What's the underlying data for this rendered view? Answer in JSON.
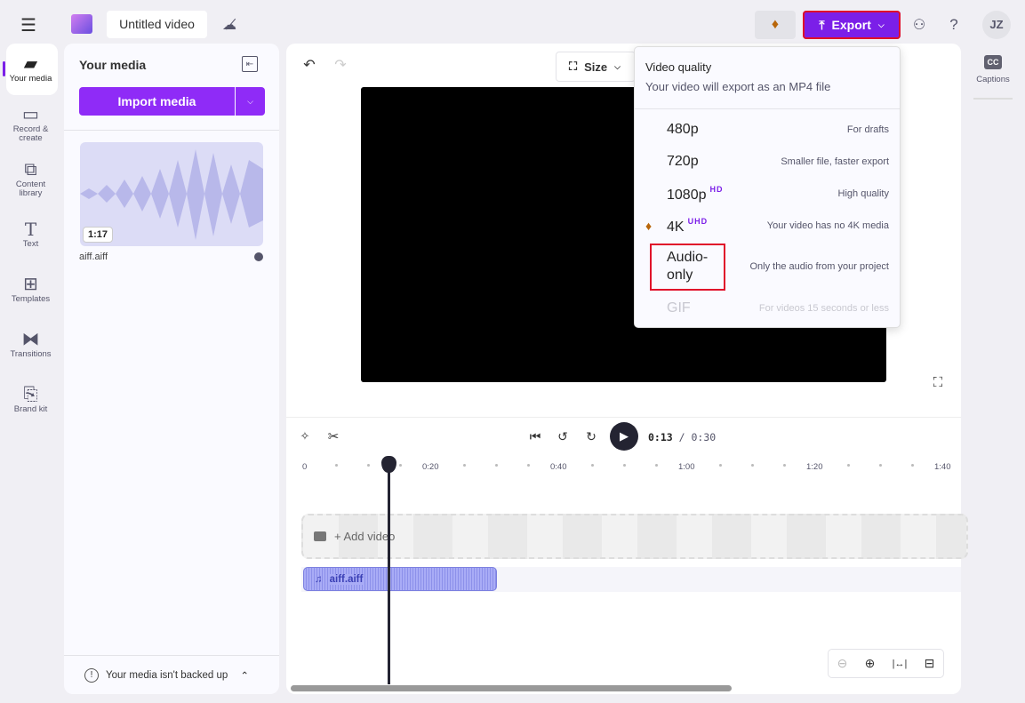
{
  "header": {
    "title": "Untitled video",
    "export_label": "Export",
    "avatar": "JZ"
  },
  "nav": [
    {
      "label": "Your media",
      "icon": "folder-icon"
    },
    {
      "label": "Record & create",
      "icon": "camera-icon"
    },
    {
      "label": "Content library",
      "icon": "library-icon"
    },
    {
      "label": "Text",
      "icon": "text-icon"
    },
    {
      "label": "Templates",
      "icon": "templates-icon"
    },
    {
      "label": "Transitions",
      "icon": "transitions-icon"
    },
    {
      "label": "Brand kit",
      "icon": "brand-kit-icon"
    }
  ],
  "media": {
    "title": "Your media",
    "import_label": "Import media",
    "item": {
      "duration": "1:17",
      "name": "aiff.aiff"
    },
    "backup": "Your media isn't backed up"
  },
  "preview": {
    "size_label": "Size"
  },
  "right": {
    "captions": "Captions"
  },
  "export_menu": {
    "title": "Video quality",
    "subtitle": "Your video will export as an MP4 file",
    "options": [
      {
        "name": "480p",
        "badge": "",
        "desc": "For drafts"
      },
      {
        "name": "720p",
        "badge": "",
        "desc": "Smaller file, faster export"
      },
      {
        "name": "1080p",
        "badge": "HD",
        "desc": "High quality"
      },
      {
        "name": "4K",
        "badge": "UHD",
        "desc": "Your video has no 4K media"
      },
      {
        "name": "Audio-only",
        "badge": "",
        "desc": "Only the audio from your project"
      },
      {
        "name": "GIF",
        "badge": "",
        "desc": "For videos 15 seconds or less"
      }
    ]
  },
  "timeline": {
    "current": "0:13",
    "total": "/ 0:30",
    "ticks": [
      "0",
      "0:20",
      "0:40",
      "1:00",
      "1:20",
      "1:40"
    ],
    "add_video": "+ Add video",
    "audio_clip": "aiff.aiff",
    "accent": "#7b1fe8"
  }
}
